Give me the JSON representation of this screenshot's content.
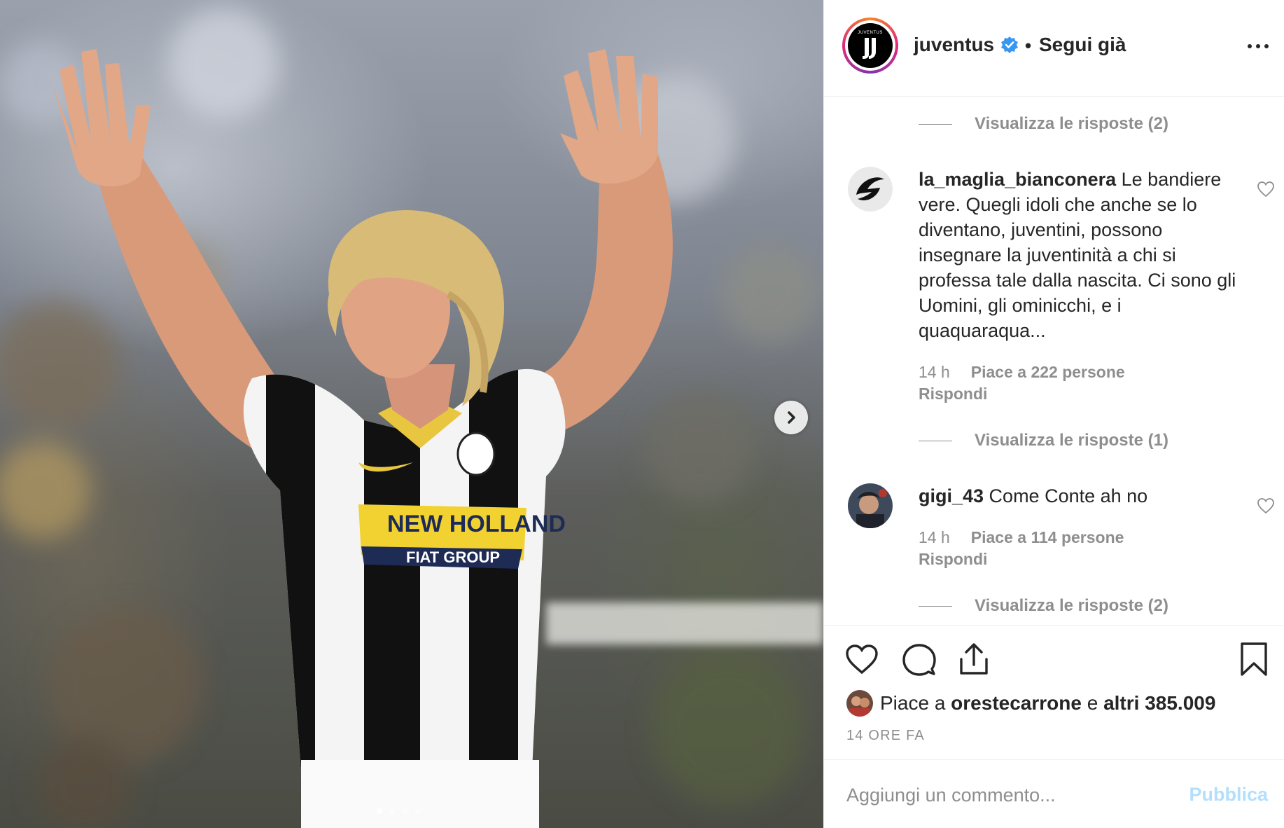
{
  "post": {
    "image_alt": "Juventus player in black and white striped shirt raising both hands",
    "sponsor_line1": "NEW HOLLAND",
    "sponsor_line2": "FIAT GROUP",
    "carousel": {
      "total": 4,
      "current": 1
    }
  },
  "header": {
    "username": "juventus",
    "avatar_wordmark": "JUVENTUS",
    "follow_status": "Segui già",
    "separator": "•"
  },
  "comments": {
    "top_view_replies": "Visualizza le risposte (2)",
    "items": [
      {
        "username": "la_maglia_bianconera",
        "text": " Le bandiere vere. Quegli idoli che anche se lo diventano, juventini, possono insegnare la juventinità a chi si professa tale dalla nascita. Ci sono gli Uomini, gli ominicchi, e i quaquaraqua...",
        "time": "14 h",
        "likes": "Piace a 222 persone",
        "reply": "Rispondi",
        "view_replies": "Visualizza le risposte (1)"
      },
      {
        "username": "gigi_43",
        "text": " Come Conte ah no",
        "time": "14 h",
        "likes": "Piace a 114 persone",
        "reply": "Rispondi",
        "view_replies": "Visualizza le risposte (2)"
      }
    ]
  },
  "likes": {
    "prefix": "Piace a ",
    "user": "orestecarrone",
    "middle": " e ",
    "others": "altri 385.009"
  },
  "post_time": "14 ORE FA",
  "add_comment": {
    "placeholder": "Aggiungi un commento...",
    "publish": "Pubblica"
  },
  "colors": {
    "text": "#262626",
    "muted": "#8e8e8e",
    "verified": "#3897f0",
    "publish_disabled": "#b2dffc",
    "shirt_stripe": "#111111",
    "sponsor_yellow": "#f2d230",
    "sponsor_navy": "#1d2b55"
  },
  "icons": [
    "verified-badge-icon",
    "more-options-icon",
    "chevron-right-icon",
    "heart-icon",
    "comment-icon",
    "share-icon",
    "bookmark-icon"
  ]
}
